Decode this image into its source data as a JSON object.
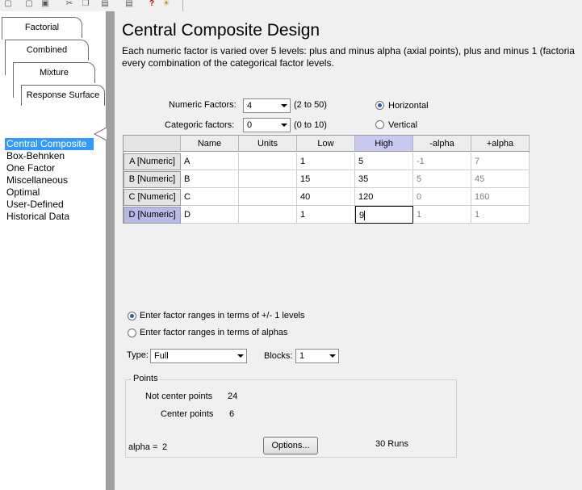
{
  "toolbar": {
    "icons": [
      "new-icon",
      "save-icon",
      "cut-icon",
      "copy-icon",
      "paste-icon",
      "print-icon",
      "help-icon",
      "tip-icon"
    ]
  },
  "tabs": [
    "Factorial",
    "Combined",
    "Mixture",
    "Response Surface"
  ],
  "nav": {
    "items": [
      "Central Composite",
      "Box-Behnken",
      "One Factor",
      "Miscellaneous",
      "Optimal",
      "User-Defined",
      "Historical Data"
    ],
    "selected_index": 0
  },
  "page": {
    "title": "Central Composite Design",
    "desc_line1": "Each numeric factor is varied over 5 levels: plus and minus alpha (axial points), plus and minus 1 (factoria",
    "desc_line2": "every combination of the categorical factor levels."
  },
  "factors": {
    "numeric_label": "Numeric Factors:",
    "numeric_value": "4",
    "numeric_range": "(2 to 50)",
    "categoric_label": "Categoric factors:",
    "categoric_value": "0",
    "categoric_range": "(0 to 10)",
    "orientation_horizontal": "Horizontal",
    "orientation_vertical": "Vertical",
    "orientation_selected": "Horizontal"
  },
  "table": {
    "columns": [
      "Name",
      "Units",
      "Low",
      "High",
      "-alpha",
      "+alpha"
    ],
    "highlight_column": "High",
    "rows": [
      {
        "header": "A [Numeric]",
        "name": "A",
        "units": "",
        "low": "1",
        "high": "5",
        "minus_alpha": "-1",
        "plus_alpha": "7"
      },
      {
        "header": "B [Numeric]",
        "name": "B",
        "units": "",
        "low": "15",
        "high": "35",
        "minus_alpha": "5",
        "plus_alpha": "45"
      },
      {
        "header": "C [Numeric]",
        "name": "C",
        "units": "",
        "low": "40",
        "high": "120",
        "minus_alpha": "0",
        "plus_alpha": "160"
      },
      {
        "header": "D [Numeric]",
        "name": "D",
        "units": "",
        "low": "1",
        "high": "9",
        "minus_alpha": "1",
        "plus_alpha": "1"
      }
    ],
    "active_row": 3
  },
  "ranges": {
    "option_levels": "Enter factor ranges in terms of +/- 1 levels",
    "option_alphas": "Enter factor ranges in terms of alphas",
    "selected": "levels"
  },
  "design": {
    "type_label": "Type:",
    "type_value": "Full",
    "blocks_label": "Blocks:",
    "blocks_value": "1"
  },
  "points": {
    "group_title": "Points",
    "not_center_label": "Not center points",
    "not_center_value": "24",
    "center_label": "Center points",
    "center_value": "6",
    "alpha_label": "alpha =",
    "alpha_value": "2",
    "options_button": "Options...",
    "runs_text": "30 Runs"
  }
}
